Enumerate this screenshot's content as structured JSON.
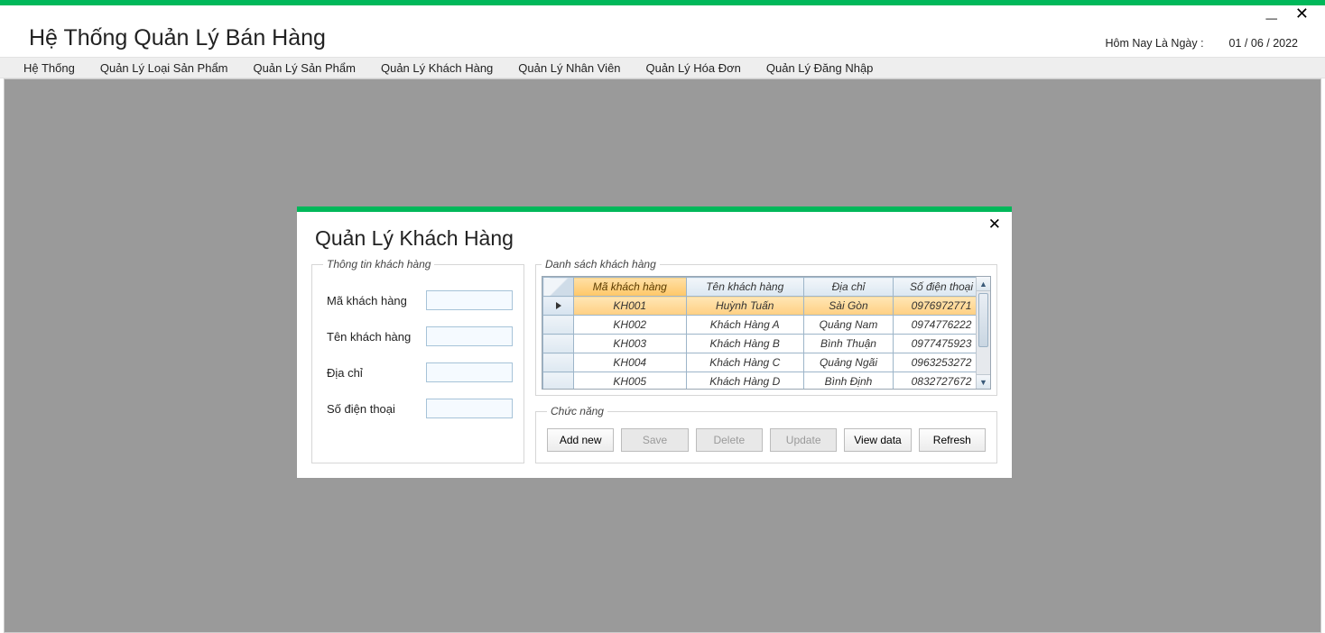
{
  "app": {
    "title": "Hệ Thống Quản Lý Bán Hàng",
    "date_label": "Hôm Nay Là Ngày :",
    "date_value": "01 / 06 / 2022"
  },
  "menu": {
    "items": [
      "Hệ Thống",
      "Quản Lý Loại Sản Phẩm",
      "Quản Lý Sản Phẩm",
      "Quản Lý Khách Hàng",
      "Quản Lý Nhân Viên",
      "Quản Lý Hóa Đơn",
      "Quản Lý Đăng Nhập"
    ]
  },
  "modal": {
    "title": "Quản Lý Khách Hàng",
    "info_legend": "Thông tin khách hàng",
    "list_legend": "Danh sách khách hàng",
    "func_legend": "Chức năng",
    "form": {
      "ma_label": "Mã khách hàng",
      "ma_value": "",
      "ten_label": "Tên khách hàng",
      "ten_value": "",
      "diachi_label": "Địa chỉ",
      "diachi_value": "",
      "sdt_label": "Số điện thoại",
      "sdt_value": ""
    },
    "grid": {
      "columns": [
        "Mã khách hàng",
        "Tên khách hàng",
        "Địa chỉ",
        "Số điện thoại"
      ],
      "selected_column_index": 0,
      "selected_row_index": 0,
      "rows": [
        {
          "ma": "KH001",
          "ten": "Huỳnh Tuấn",
          "diachi": "Sài Gòn",
          "sdt": "0976972771"
        },
        {
          "ma": "KH002",
          "ten": "Khách Hàng A",
          "diachi": "Quảng Nam",
          "sdt": "0974776222"
        },
        {
          "ma": "KH003",
          "ten": "Khách Hàng B",
          "diachi": "Bình Thuận",
          "sdt": "0977475923"
        },
        {
          "ma": "KH004",
          "ten": "Khách Hàng C",
          "diachi": "Quảng Ngãi",
          "sdt": "0963253272"
        },
        {
          "ma": "KH005",
          "ten": "Khách Hàng D",
          "diachi": "Bình Định",
          "sdt": "0832727672"
        }
      ]
    },
    "buttons": {
      "add": "Add new",
      "save": "Save",
      "delete": "Delete",
      "update": "Update",
      "view": "View data",
      "refresh": "Refresh"
    }
  }
}
